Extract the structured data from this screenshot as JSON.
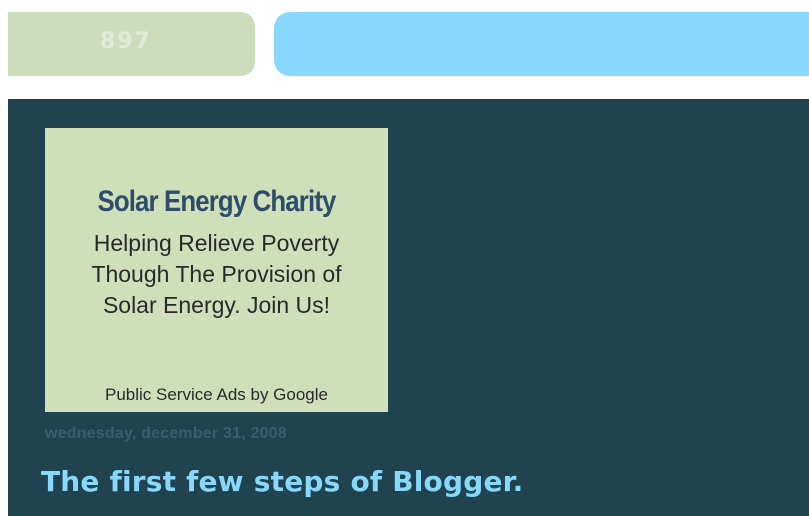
{
  "header": {
    "counter_value": "897"
  },
  "ad": {
    "title": "Solar Energy Charity",
    "body_lines": [
      "Helping Relieve Poverty",
      "Though The Provision of",
      "Solar Energy. Join Us!"
    ],
    "footer": "Public Service Ads by Google"
  },
  "post": {
    "date": "wednesday, december 31, 2008",
    "title": "The first few steps of Blogger."
  },
  "colors": {
    "counter_bg": "#cddcbb",
    "header_bar": "#88d8fb",
    "main_bg": "#21424f",
    "ad_bg": "#cfdfba",
    "ad_title": "#2d4d6b",
    "post_title": "#88d8fb",
    "post_date": "#3b5e6d"
  }
}
